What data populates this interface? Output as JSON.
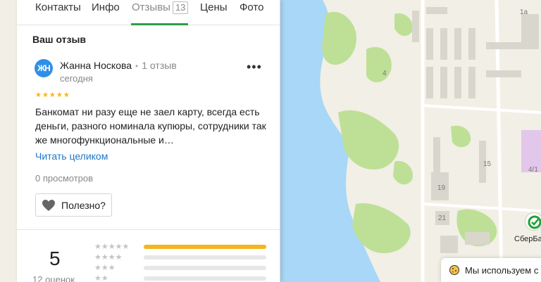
{
  "tabs": [
    {
      "label": "Контакты"
    },
    {
      "label": "Инфо"
    },
    {
      "label": "Отзывы",
      "count": "13"
    },
    {
      "label": "Цены"
    },
    {
      "label": "Фото"
    }
  ],
  "section_title": "Ваш отзыв",
  "review": {
    "avatar_initials": "ЖН",
    "author": "Жанна Носкова",
    "author_reviews": "1 отзыв",
    "date": "сегодня",
    "more": "•••",
    "stars": "★★★★★",
    "rating": 5,
    "text": "Банкомат ни разу еще не заел карту, всегда есть деньги, разного номинала купюры, сотрудники так же многофункциональные и…",
    "read_more": "Читать целиком",
    "views": "0 просмотров",
    "useful_label": "Полезно?"
  },
  "summary": {
    "rating": "5",
    "count": "12 оценок",
    "bars": [
      {
        "stars": "★★★★★",
        "fraction": 1.0
      },
      {
        "stars": "★★★★",
        "fraction": 0
      },
      {
        "stars": "★★★",
        "fraction": 0
      },
      {
        "stars": "★★",
        "fraction": 0
      }
    ]
  },
  "map": {
    "labels": [
      "1а",
      "4",
      "15",
      "19",
      "21",
      "4/1"
    ],
    "poi": "СберБа"
  },
  "cookie_banner": {
    "text": "Мы используем с"
  },
  "colors": {
    "accent_green": "#2e9d4b",
    "link_blue": "#1f77c9",
    "star_yellow": "#f5b51e",
    "water": "#9fd3f5",
    "land": "#f3f0e6",
    "park": "#b8df8f"
  }
}
